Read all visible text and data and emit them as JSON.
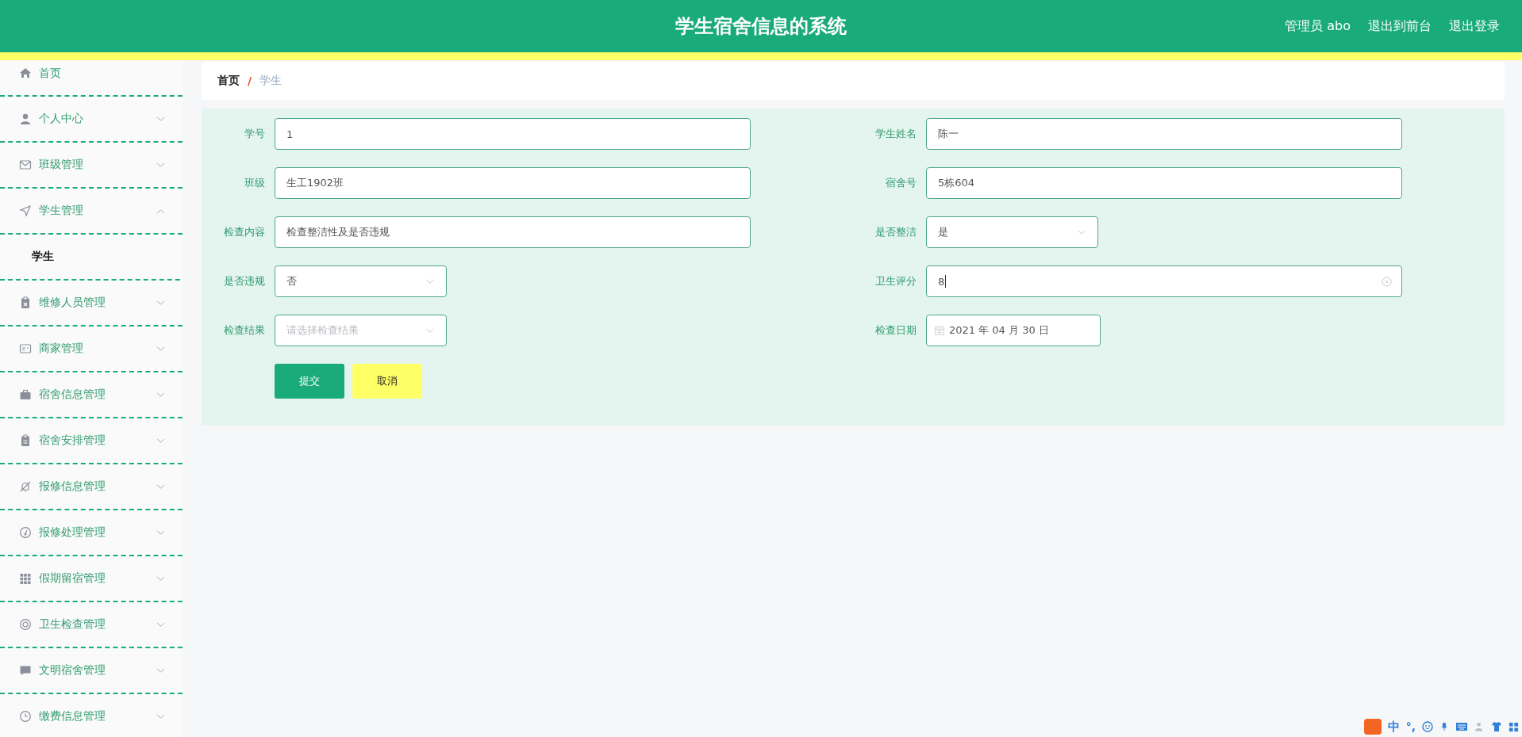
{
  "header": {
    "title": "学生宿舍信息的系统",
    "links": [
      "管理员 abo",
      "退出到前台",
      "退出登录"
    ]
  },
  "sidebar": {
    "items": [
      {
        "label": "首页",
        "kind": "link"
      },
      {
        "label": "个人中心",
        "kind": "submenu",
        "expanded": false
      },
      {
        "label": "班级管理",
        "kind": "submenu",
        "expanded": false
      },
      {
        "label": "学生管理",
        "kind": "submenu",
        "expanded": true,
        "children": [
          {
            "label": "学生",
            "selected": true
          }
        ]
      },
      {
        "label": "维修人员管理",
        "kind": "submenu",
        "expanded": false
      },
      {
        "label": "商家管理",
        "kind": "submenu",
        "expanded": false
      },
      {
        "label": "宿舍信息管理",
        "kind": "submenu",
        "expanded": false
      },
      {
        "label": "宿舍安排管理",
        "kind": "submenu",
        "expanded": false
      },
      {
        "label": "报修信息管理",
        "kind": "submenu",
        "expanded": false
      },
      {
        "label": "报修处理管理",
        "kind": "submenu",
        "expanded": false
      },
      {
        "label": "假期留宿管理",
        "kind": "submenu",
        "expanded": false
      },
      {
        "label": "卫生检查管理",
        "kind": "submenu",
        "expanded": false
      },
      {
        "label": "文明宿舍管理",
        "kind": "submenu",
        "expanded": false
      },
      {
        "label": "缴费信息管理",
        "kind": "submenu",
        "expanded": false
      }
    ]
  },
  "breadcrumb": {
    "items": [
      "首页",
      "学生"
    ],
    "separator": "/"
  },
  "form": {
    "fields": [
      {
        "label": "学号",
        "kind": "text",
        "value": "1"
      },
      {
        "label": "学生姓名",
        "kind": "text",
        "value": "陈一"
      },
      {
        "label": "班级",
        "kind": "text",
        "value": "生工1902班"
      },
      {
        "label": "宿舍号",
        "kind": "text",
        "value": "5栋604"
      },
      {
        "label": "检查内容",
        "kind": "text",
        "value": "检查整洁性及是否违规"
      },
      {
        "label": "是否整洁",
        "kind": "select",
        "value": "是"
      },
      {
        "label": "是否违规",
        "kind": "select",
        "value": "否"
      },
      {
        "label": "卫生评分",
        "kind": "text",
        "value": "8",
        "focused": true
      },
      {
        "label": "检查结果",
        "kind": "select",
        "placeholder": "请选择检查结果"
      },
      {
        "label": "检查日期",
        "kind": "date",
        "value": "2021 年 04 月 30 日"
      }
    ],
    "buttons": [
      {
        "label": "提交",
        "kind": "primary"
      },
      {
        "label": "取消",
        "kind": "cancel"
      }
    ]
  },
  "ime_bar": {
    "mode": "中",
    "punctuation": "°,"
  }
}
